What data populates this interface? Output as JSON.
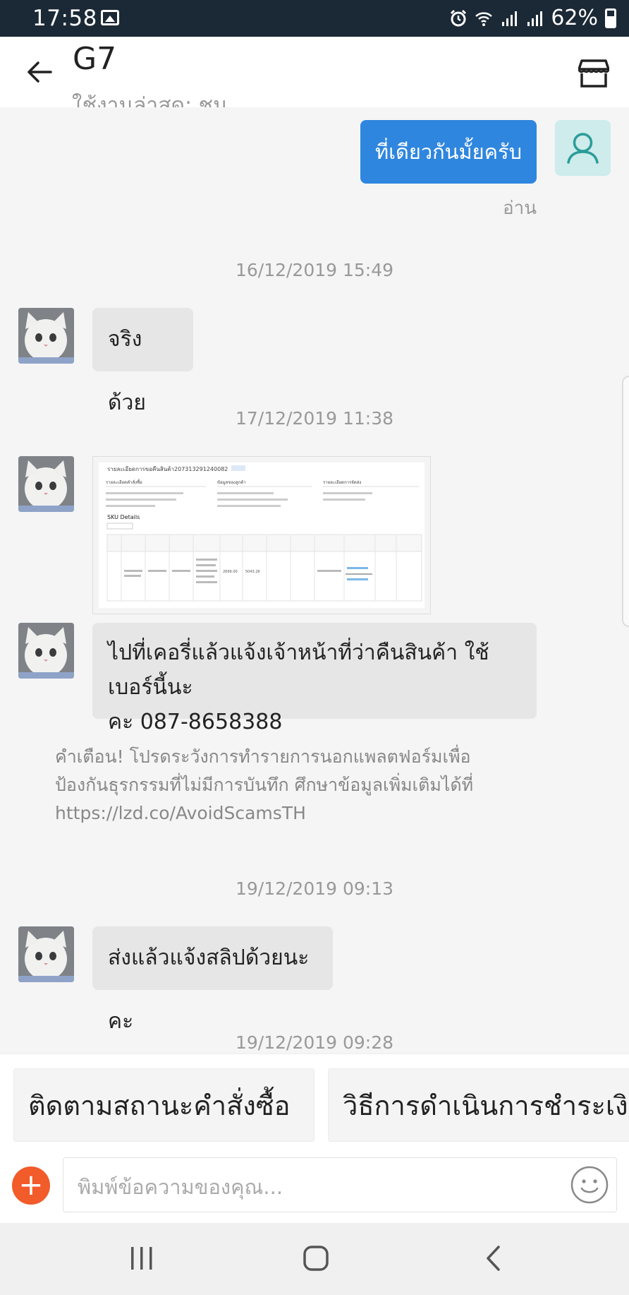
{
  "status_bar": {
    "time": "17:58",
    "battery": "62%"
  },
  "header": {
    "title": "G7",
    "subtitle": "ใช้งานล่าสุด: ชม"
  },
  "messages": {
    "me_text": "ที่เดียวกันมั้ยครับ",
    "read_label": "อ่าน",
    "ts1": "16/12/2019 15:49",
    "msg1": "จริงด้วย",
    "ts2": "17/12/2019 11:38",
    "msg2_line1": "ไปที่เคอรี่แล้วแจ้งเจ้าหน้าที่ว่าคืนสินค้า ใช้เบอร์นี้นะ",
    "msg2_line2": "คะ 087-8658388",
    "warning_line1": "คำเตือน! โปรดระวังการทำรายการนอกแพลตฟอร์มเพื่อ",
    "warning_line2": "ป้องกันธุรกรรมที่ไม่มีการบันทึก ศึกษาข้อมูลเพิ่มเติมได้ที่",
    "warning_link": "https://lzd.co/AvoidScamsTH",
    "ts3": "19/12/2019 09:13",
    "msg3": "ส่งแล้วแจ้งสลิปด้วยนะคะ",
    "ts4": "19/12/2019 09:28"
  },
  "screenshot_message": {
    "title": "รายละเอียดการขอคืนสินค้า207313291240082",
    "section_left": "รายละเอียดคำสั่งซื้อ",
    "section_mid": "ข้อมูลของลูกค้า",
    "section_right": "รายละเอียดการจัดส่ง",
    "sku_heading": "SKU Details",
    "cell_price": "2699.00",
    "cell_total": "5043.26"
  },
  "quick_replies": [
    "ติดตามสถานะคำสั่งซื้อ",
    "วิธีการดำเนินการชำระเงิน"
  ],
  "composer": {
    "placeholder": "พิมพ์ข้อความของคุณ..."
  },
  "colors": {
    "accent": "#2f86de",
    "plus": "#f25b2a",
    "status_bar": "#1b2836"
  }
}
